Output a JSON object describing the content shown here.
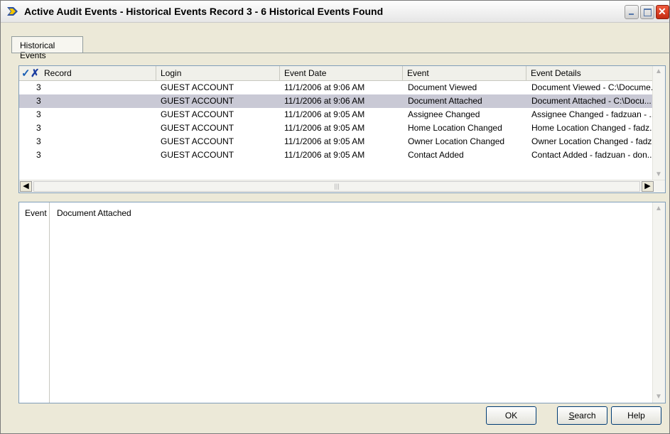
{
  "window": {
    "title": "Active Audit Events - Historical Events Record 3 - 6 Historical Events Found",
    "icon": "app-arrow-icon"
  },
  "tabs": [
    {
      "label": "Historical Events",
      "active": true
    }
  ],
  "grid": {
    "columns": [
      "Record",
      "Login",
      "Event Date",
      "Event",
      "Event Details"
    ],
    "selected_row": 1,
    "rows": [
      {
        "record": "3",
        "login": "GUEST ACCOUNT",
        "date": "11/1/2006 at 9:06 AM",
        "event": "Document Viewed",
        "details": "Document Viewed - C:\\Docume..."
      },
      {
        "record": "3",
        "login": "GUEST ACCOUNT",
        "date": "11/1/2006 at 9:06 AM",
        "event": "Document Attached",
        "details": "Document Attached - C:\\Docu..."
      },
      {
        "record": "3",
        "login": "GUEST ACCOUNT",
        "date": "11/1/2006 at 9:05 AM",
        "event": "Assignee Changed",
        "details": "Assignee Changed - fadzuan - ..."
      },
      {
        "record": "3",
        "login": "GUEST ACCOUNT",
        "date": "11/1/2006 at 9:05 AM",
        "event": "Home Location Changed",
        "details": "Home Location Changed - fadz..."
      },
      {
        "record": "3",
        "login": "GUEST ACCOUNT",
        "date": "11/1/2006 at 9:05 AM",
        "event": "Owner Location Changed",
        "details": "Owner Location Changed - fadz..."
      },
      {
        "record": "3",
        "login": "GUEST ACCOUNT",
        "date": "11/1/2006 at 9:05 AM",
        "event": "Contact Added",
        "details": "Contact Added - fadzuan - don..."
      }
    ]
  },
  "detail": {
    "label": "Event",
    "value": "Document Attached"
  },
  "buttons": {
    "ok": "OK",
    "search_first": "S",
    "search_rest": "earch",
    "help": "Help"
  },
  "colors": {
    "selected_row": "#c9c9d5",
    "window_bg": "#ece9d8"
  }
}
